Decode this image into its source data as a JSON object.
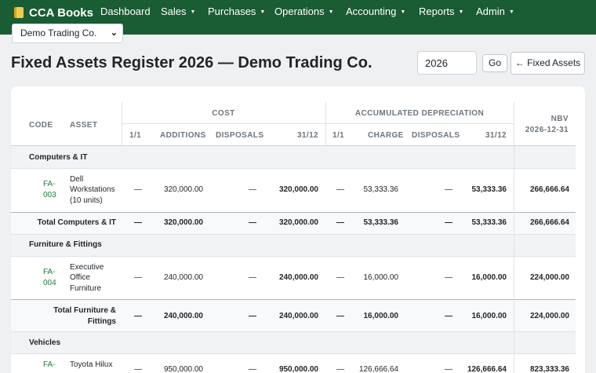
{
  "app": {
    "brand": "CCA Books",
    "brand_icon": "book-icon",
    "nav": [
      {
        "label": "Dashboard",
        "dropdown": false
      },
      {
        "label": "Sales",
        "dropdown": true
      },
      {
        "label": "Purchases",
        "dropdown": true
      },
      {
        "label": "Operations",
        "dropdown": true
      },
      {
        "label": "Accounting",
        "dropdown": true
      },
      {
        "label": "Reports",
        "dropdown": true
      },
      {
        "label": "Admin",
        "dropdown": true
      }
    ],
    "company_selected": "Demo Trading Co.",
    "nav_color": "#1a5c34"
  },
  "page": {
    "title": "Fixed Assets Register 2026 — Demo Trading Co.",
    "year_value": "2026",
    "go_label": "Go",
    "back_label": "← Fixed Assets"
  },
  "table": {
    "headers": {
      "code": "CODE",
      "asset": "ASSET",
      "cost": "COST",
      "accum": "ACCUMULATED DEPRECIATION",
      "nbv": "NBV",
      "nbv_date": "2026-12-31",
      "cost_open": "1/1",
      "additions": "ADDITIONS",
      "disposals": "DISPOSALS",
      "cost_close": "31/12",
      "dep_open": "1/1",
      "charge": "CHARGE",
      "dep_disposals": "DISPOSALS",
      "dep_close": "31/12"
    },
    "groups": [
      {
        "name": "Computers & IT",
        "asset": {
          "code_1": "FA-",
          "code_2": "003",
          "name_1": "Dell",
          "name_2": "Workstations",
          "name_3": "(10 units)",
          "cost_open": "—",
          "additions": "320,000.00",
          "disposals": "—",
          "cost_close": "320,000.00",
          "dep_open": "—",
          "charge": "53,333.36",
          "dep_disposals": "—",
          "dep_close": "53,333.36",
          "nbv": "266,666.64"
        },
        "total": {
          "label": "Total Computers & IT",
          "cost_open": "—",
          "additions": "320,000.00",
          "disposals": "—",
          "cost_close": "320,000.00",
          "dep_open": "—",
          "charge": "53,333.36",
          "dep_disposals": "—",
          "dep_close": "53,333.36",
          "nbv": "266,666.64"
        }
      },
      {
        "name": "Furniture & Fittings",
        "asset": {
          "code_1": "FA-",
          "code_2": "004",
          "name_1": "Executive",
          "name_2": "Office",
          "name_3": "Furniture",
          "cost_open": "—",
          "additions": "240,000.00",
          "disposals": "—",
          "cost_close": "240,000.00",
          "dep_open": "—",
          "charge": "16,000.00",
          "dep_disposals": "—",
          "dep_close": "16,000.00",
          "nbv": "224,000.00"
        },
        "total": {
          "label_1": "Total Furniture &",
          "label_2": "Fittings",
          "cost_open": "—",
          "additions": "240,000.00",
          "disposals": "—",
          "cost_close": "240,000.00",
          "dep_open": "—",
          "charge": "16,000.00",
          "dep_disposals": "—",
          "dep_close": "16,000.00",
          "nbv": "224,000.00"
        }
      },
      {
        "name": "Vehicles",
        "asset": {
          "code_1": "FA-",
          "name_1": "Toyota Hilux",
          "cost_open": "—",
          "additions": "950,000.00",
          "disposals": "—",
          "cost_close": "950,000.00",
          "dep_open": "—",
          "charge": "126,666.64",
          "dep_disposals": "—",
          "dep_close": "126,666.64",
          "nbv": "823,333.36"
        }
      }
    ]
  }
}
